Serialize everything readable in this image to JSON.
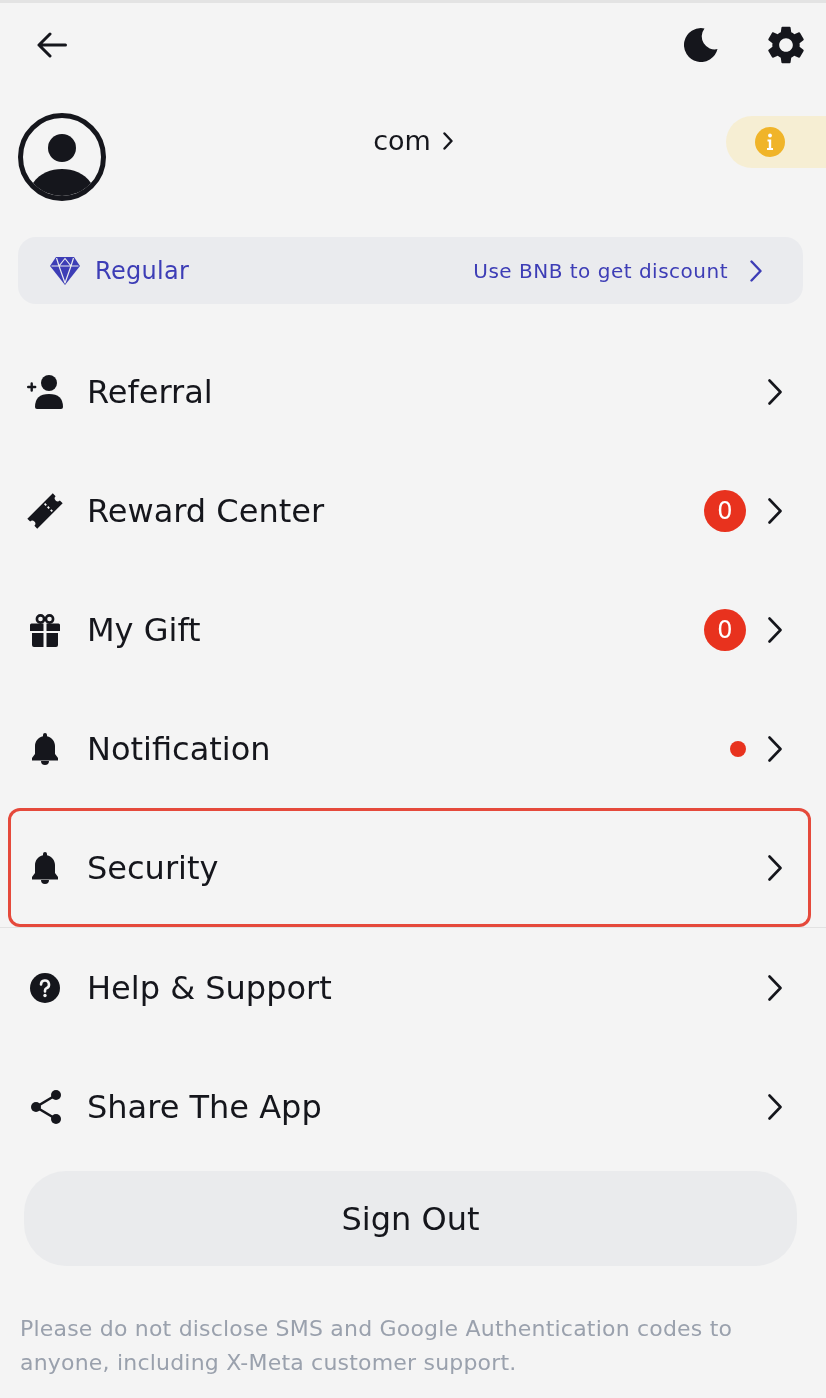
{
  "profile": {
    "account": "com"
  },
  "membership": {
    "tier": "Regular",
    "offer": "Use BNB to get discount"
  },
  "menu_sections": [
    {
      "items": [
        {
          "kind": "referral",
          "label": "Referral",
          "highlighted": false
        },
        {
          "kind": "reward",
          "label": "Reward Center",
          "badge": {
            "kind": "count",
            "text": "0"
          },
          "highlighted": false
        },
        {
          "kind": "gift",
          "label": "My Gift",
          "badge": {
            "kind": "count",
            "text": "0"
          },
          "highlighted": false
        },
        {
          "kind": "notification",
          "label": "Notification",
          "badge": {
            "kind": "dot"
          },
          "highlighted": false
        },
        {
          "kind": "security",
          "label": "Security",
          "highlighted": true
        }
      ]
    },
    {
      "items": [
        {
          "kind": "help",
          "label": "Help & Support",
          "highlighted": false
        },
        {
          "kind": "share",
          "label": "Share The App",
          "highlighted": false
        }
      ]
    }
  ],
  "sign_out": {
    "label": "Sign Out"
  },
  "notice": "Please do not disclose SMS and Google Authentication codes to anyone, including X-Meta customer support."
}
